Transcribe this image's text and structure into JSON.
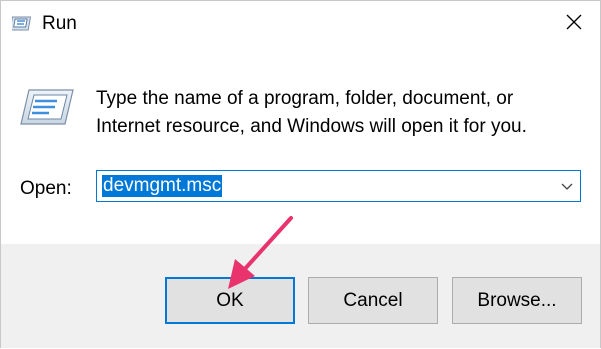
{
  "window": {
    "title": "Run",
    "close_icon": "close-icon"
  },
  "content": {
    "description_line1": "Type the name of a program, folder, document, or",
    "description_line2": "Internet resource, and Windows will open it for you.",
    "open_label": "Open:",
    "open_value": "devmgmt.msc"
  },
  "buttons": {
    "ok": "OK",
    "cancel": "Cancel",
    "browse": "Browse..."
  },
  "colors": {
    "accent": "#0078d7",
    "annotation_arrow": "#e8336d",
    "button_face": "#e1e1e1",
    "bottom_bar": "#f0f0f0"
  }
}
